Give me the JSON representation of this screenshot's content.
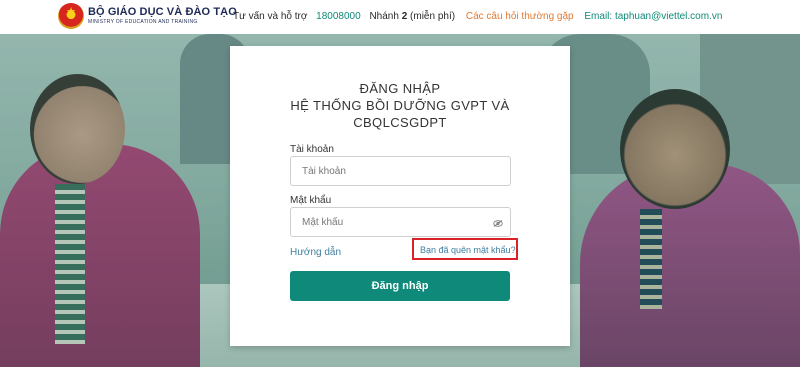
{
  "header": {
    "logo_title": "BỘ GIÁO DỤC VÀ ĐÀO TẠO",
    "logo_subtitle": "MINISTRY OF EDUCATION AND TRAINING",
    "support_label": "Tư vấn và hỗ trợ",
    "hotline": "18008000",
    "extension_prefix": "Nhánh",
    "extension_number": "2",
    "extension_suffix": "(miễn phí)",
    "faq_link": "Các câu hỏi thường gặp",
    "email": "Email: taphuan@viettel.com.vn"
  },
  "login": {
    "title_line1": "ĐĂNG NHẬP",
    "title_line2": "HỆ THỐNG BỒI DƯỠNG GVPT VÀ",
    "title_line3": "CBQLCSGDPT",
    "username_label": "Tài khoản",
    "username_placeholder": "Tài khoản",
    "password_label": "Mật khẩu",
    "password_placeholder": "Mật khẩu",
    "guide_link": "Hướng dẫn",
    "forgot_link": "Bạn đã quên mật khẩu?",
    "submit_label": "Đăng nhập"
  },
  "icons": {
    "emblem": "national-emblem-icon",
    "password_toggle": "eye-slash-icon"
  },
  "colors": {
    "primary": "#0f8a7a",
    "faq": "#e07a32",
    "highlight_box": "#d9212a",
    "link": "#3e7fa1"
  }
}
